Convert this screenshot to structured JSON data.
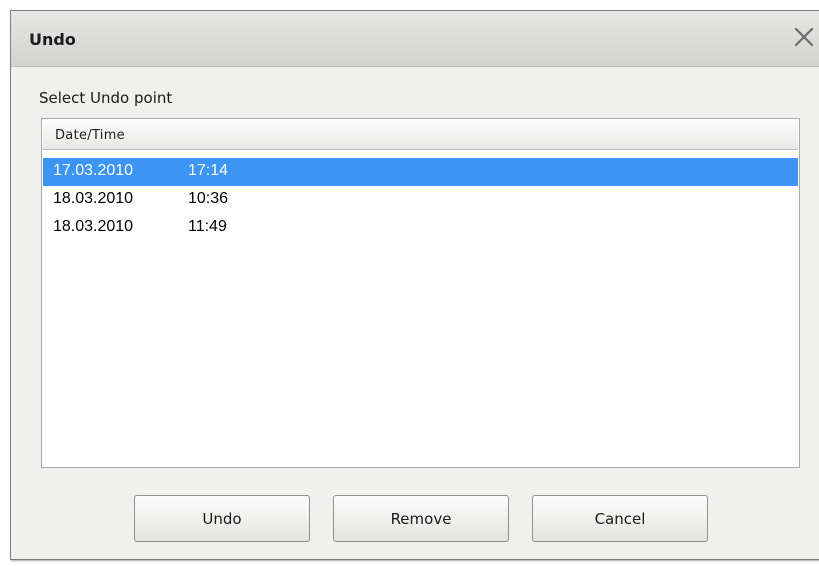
{
  "dialog": {
    "title": "Undo",
    "close_icon": "close-icon",
    "prompt": "Select Undo point",
    "list": {
      "columns": [
        "Date/Time"
      ],
      "rows": [
        {
          "date": "17.03.2010",
          "time": "17:14",
          "selected": true
        },
        {
          "date": "18.03.2010",
          "time": "10:36",
          "selected": false
        },
        {
          "date": "18.03.2010",
          "time": "11:49",
          "selected": false
        }
      ]
    },
    "buttons": {
      "undo": "Undo",
      "remove": "Remove",
      "cancel": "Cancel"
    }
  },
  "colors": {
    "selection": "#3c94f5",
    "titlebar": "#dadad8",
    "dialog_bg": "#f0f0ee"
  }
}
